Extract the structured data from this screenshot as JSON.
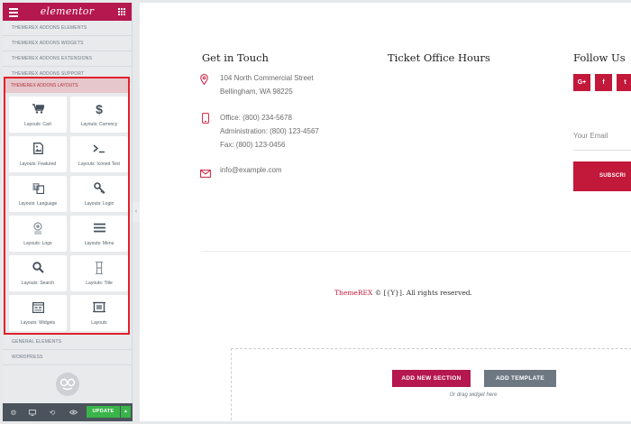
{
  "panel": {
    "logo": "elementor",
    "categories_top": [
      "THEMEREX ADDONS ELEMENTS",
      "THEMEREX ADDONS WIDGETS",
      "THEMEREX ADDONS EXTENSIONS",
      "THEMEREX ADDONS SUPPORT"
    ],
    "open_category": "THEMEREX ADDONS LAYOUTS",
    "widgets": [
      {
        "label": "Layouts: Cart",
        "icon": "cart-icon"
      },
      {
        "label": "Layouts: Currency",
        "icon": "dollar-icon"
      },
      {
        "label": "Layouts: Featured",
        "icon": "image-icon"
      },
      {
        "label": "Layouts: Iconed Text",
        "icon": "terminal-icon"
      },
      {
        "label": "Layouts: Language",
        "icon": "translate-icon"
      },
      {
        "label": "Layouts: Login",
        "icon": "key-icon"
      },
      {
        "label": "Layouts: Logo",
        "icon": "logo-icon"
      },
      {
        "label": "Layouts: Menu",
        "icon": "menu-icon"
      },
      {
        "label": "Layouts: Search",
        "icon": "search-icon"
      },
      {
        "label": "Layouts: Title",
        "icon": "title-icon"
      },
      {
        "label": "Layouts: Widgets",
        "icon": "widgets-icon"
      },
      {
        "label": "Layouts",
        "icon": "layouts-icon"
      }
    ],
    "categories_bottom": [
      "GENERAL ELEMENTS",
      "WORDPRESS"
    ],
    "footer": {
      "update_label": "UPDATE",
      "icons": [
        "settings-icon",
        "responsive-icon",
        "history-icon",
        "preview-icon"
      ]
    }
  },
  "page": {
    "contact": {
      "title": "Get in Touch",
      "address_line1": "104 North Commercial Street",
      "address_line2": "Bellingham, WA 98225",
      "office": "Office: (800) 234-5678",
      "administration": "Administration: (800) 123-4567",
      "fax": "Fax: (800) 123-0456",
      "email": "info@example.com"
    },
    "hours": {
      "title": "Ticket Office Hours"
    },
    "follow": {
      "title": "Follow Us",
      "socials": [
        "G+",
        "f",
        "t"
      ],
      "email_placeholder": "Your Email",
      "subscribe_label": "SUBSCRI"
    },
    "copyright": {
      "brand": "ThemeREX",
      "rest": " © [{Y}]. All rights reserved."
    },
    "drop_zone": {
      "add_section_label": "ADD NEW SECTION",
      "add_template_label": "ADD TEMPLATE",
      "hint": "Or drag widget here"
    }
  },
  "colors": {
    "brand": "#b5174f",
    "accent_red": "#c2183a",
    "highlight_border": "#e3202a",
    "update_green": "#39b54a"
  }
}
